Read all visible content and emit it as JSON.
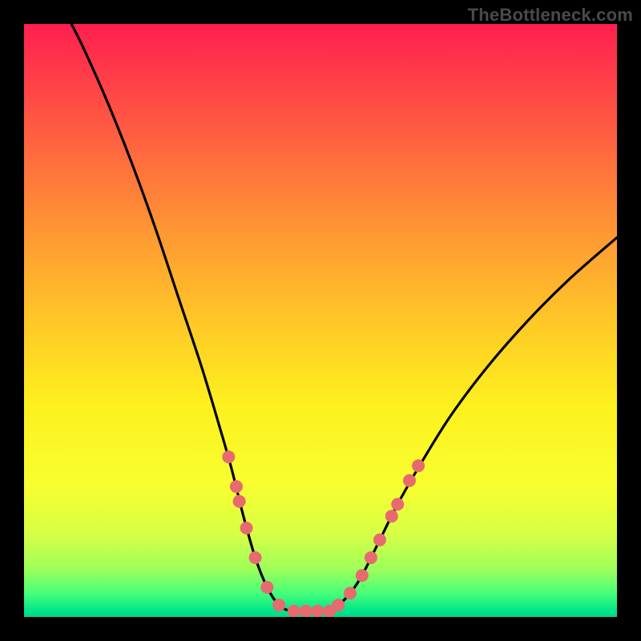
{
  "watermark": "TheBottleneck.com",
  "chart_data": {
    "type": "line",
    "title": "",
    "xlabel": "",
    "ylabel": "",
    "xlim": [
      0,
      100
    ],
    "ylim": [
      0,
      100
    ],
    "grid": false,
    "legend": false,
    "series": [
      {
        "name": "curve",
        "color": "#000000",
        "points": [
          {
            "x": 8.0,
            "y": 100.0
          },
          {
            "x": 10.0,
            "y": 96.0
          },
          {
            "x": 14.0,
            "y": 87.0
          },
          {
            "x": 18.0,
            "y": 77.0
          },
          {
            "x": 22.0,
            "y": 66.0
          },
          {
            "x": 26.0,
            "y": 54.0
          },
          {
            "x": 30.0,
            "y": 42.0
          },
          {
            "x": 33.0,
            "y": 32.0
          },
          {
            "x": 35.0,
            "y": 25.0
          },
          {
            "x": 37.0,
            "y": 17.0
          },
          {
            "x": 39.0,
            "y": 10.0
          },
          {
            "x": 41.0,
            "y": 5.0
          },
          {
            "x": 43.0,
            "y": 2.0
          },
          {
            "x": 45.0,
            "y": 1.0
          },
          {
            "x": 47.0,
            "y": 1.0
          },
          {
            "x": 49.0,
            "y": 1.0
          },
          {
            "x": 51.0,
            "y": 1.0
          },
          {
            "x": 53.0,
            "y": 2.0
          },
          {
            "x": 55.0,
            "y": 4.0
          },
          {
            "x": 57.0,
            "y": 7.0
          },
          {
            "x": 60.0,
            "y": 13.0
          },
          {
            "x": 63.0,
            "y": 19.0
          },
          {
            "x": 67.0,
            "y": 26.0
          },
          {
            "x": 72.0,
            "y": 34.0
          },
          {
            "x": 78.0,
            "y": 42.0
          },
          {
            "x": 85.0,
            "y": 50.0
          },
          {
            "x": 92.0,
            "y": 57.0
          },
          {
            "x": 100.0,
            "y": 64.0
          }
        ]
      }
    ],
    "markers": [
      {
        "x": 34.5,
        "y": 27.0
      },
      {
        "x": 35.8,
        "y": 22.0
      },
      {
        "x": 36.3,
        "y": 19.5
      },
      {
        "x": 37.5,
        "y": 15.0
      },
      {
        "x": 39.0,
        "y": 10.0
      },
      {
        "x": 41.0,
        "y": 5.0
      },
      {
        "x": 43.0,
        "y": 2.0
      },
      {
        "x": 45.5,
        "y": 1.0
      },
      {
        "x": 47.5,
        "y": 1.0
      },
      {
        "x": 49.5,
        "y": 1.0
      },
      {
        "x": 51.5,
        "y": 1.0
      },
      {
        "x": 53.0,
        "y": 2.0
      },
      {
        "x": 55.0,
        "y": 4.0
      },
      {
        "x": 57.0,
        "y": 7.0
      },
      {
        "x": 58.5,
        "y": 10.0
      },
      {
        "x": 60.0,
        "y": 13.0
      },
      {
        "x": 62.0,
        "y": 17.0
      },
      {
        "x": 63.0,
        "y": 19.0
      },
      {
        "x": 65.0,
        "y": 23.0
      },
      {
        "x": 66.5,
        "y": 25.5
      }
    ],
    "marker_color": "#e76a6f",
    "marker_radius": 8
  }
}
